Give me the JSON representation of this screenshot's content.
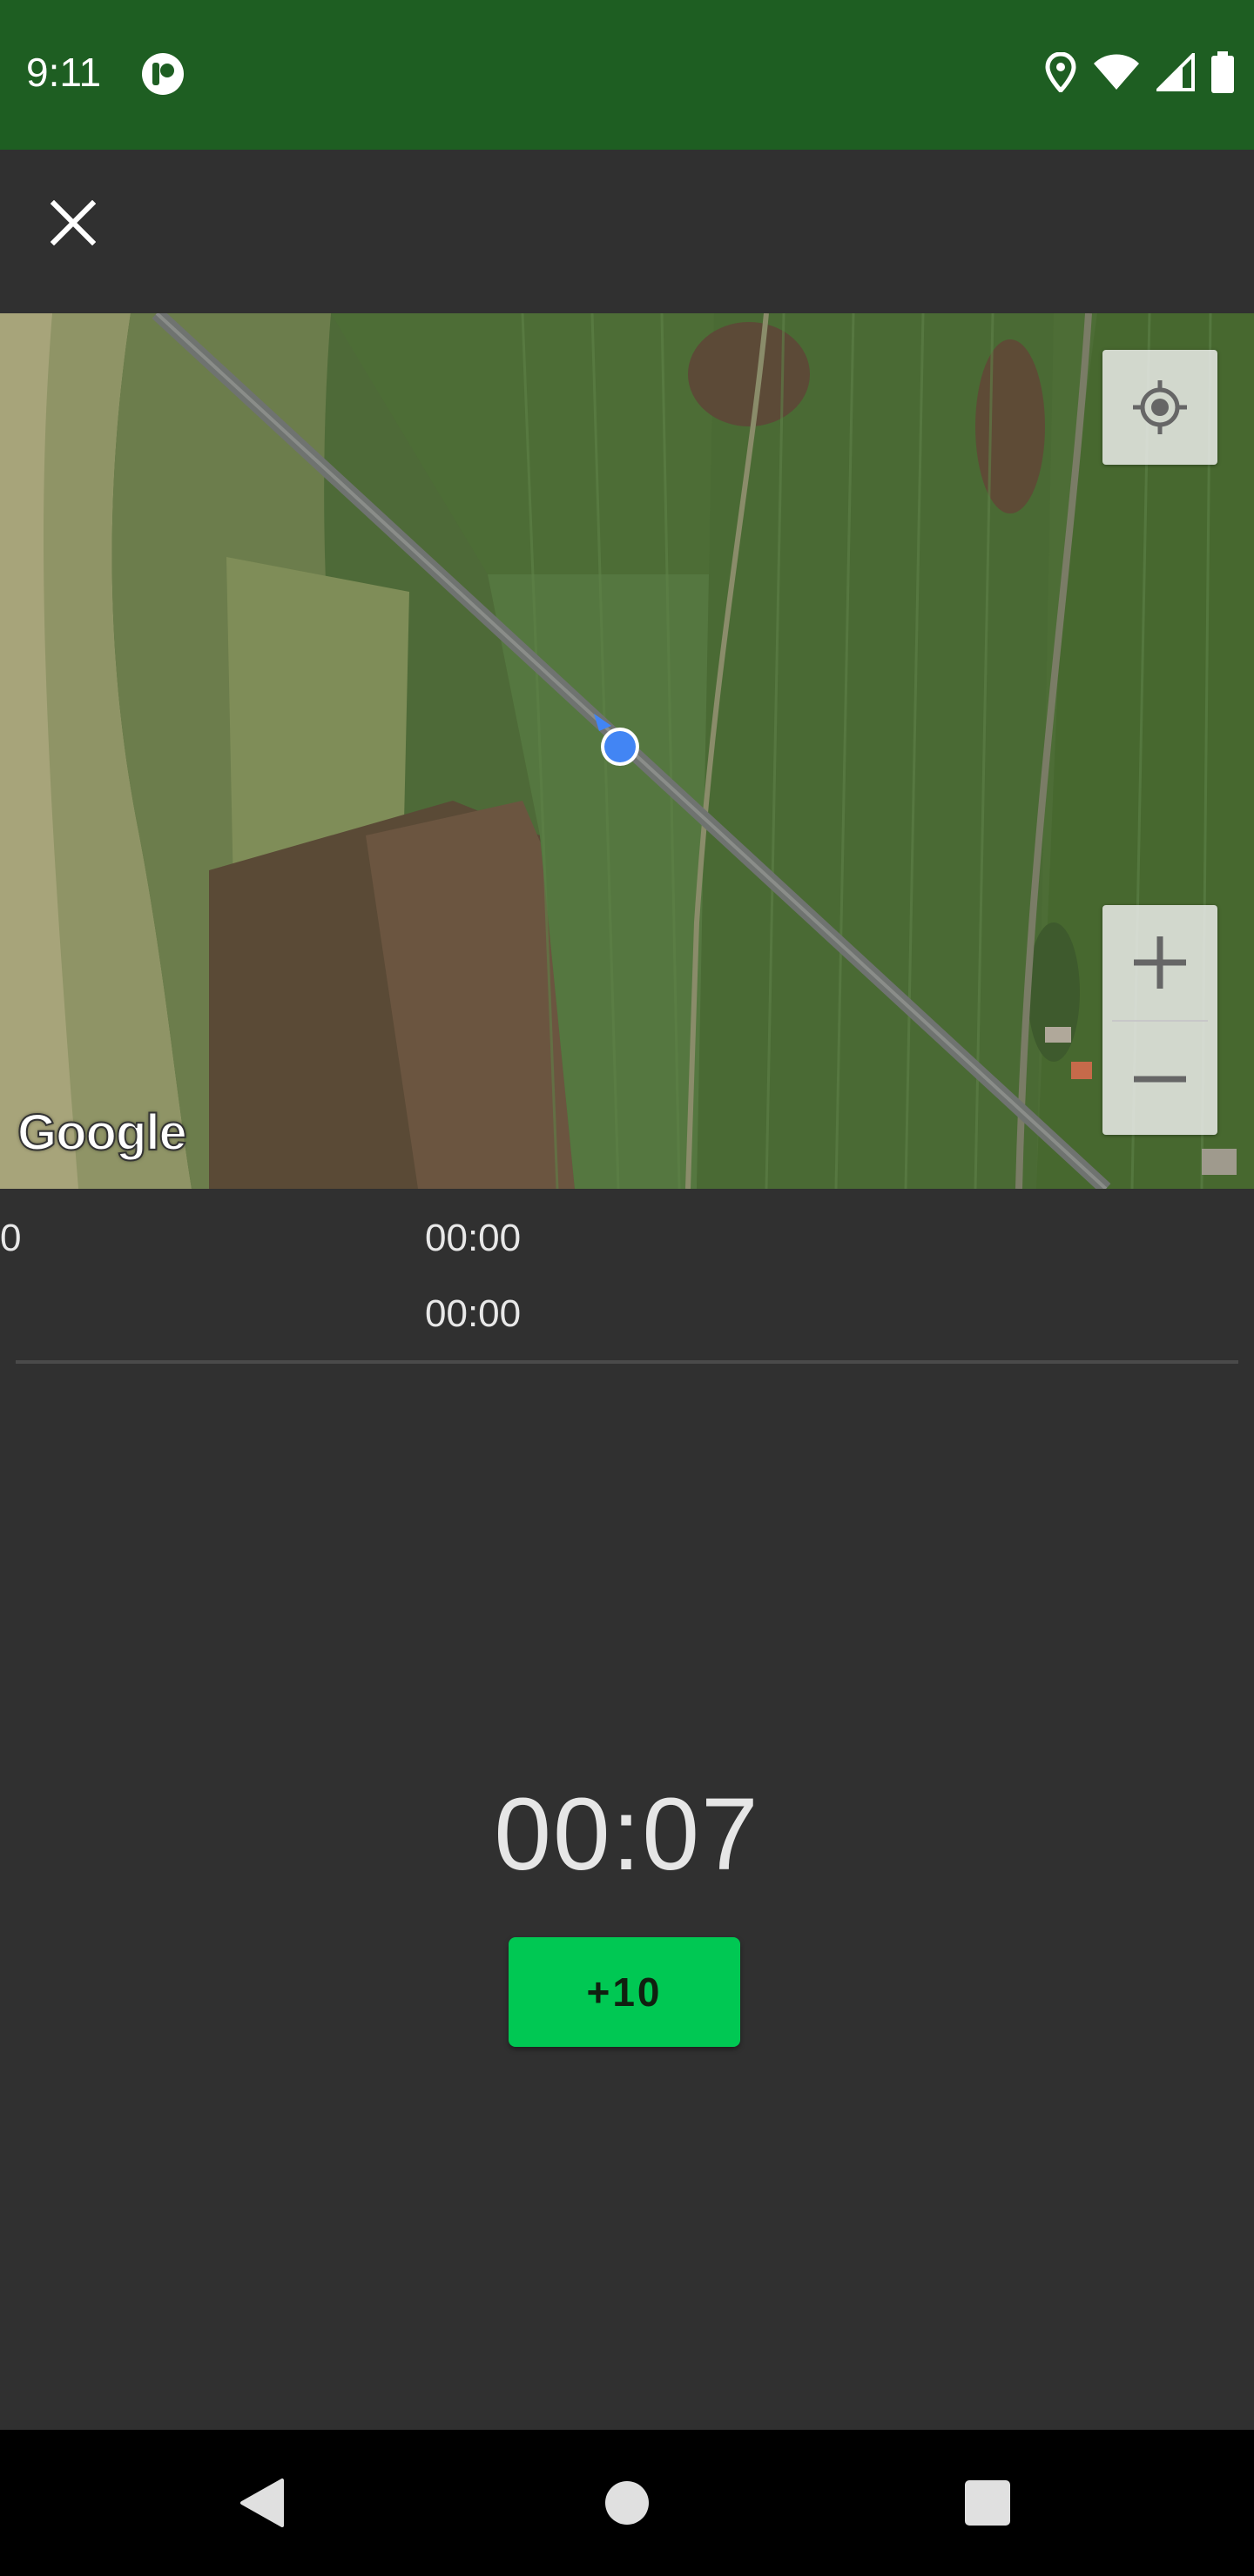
{
  "status_bar": {
    "time": "9:11"
  },
  "toolbar": {
    "close_icon": "close-icon"
  },
  "map": {
    "attribution": "Google",
    "locate_icon": "my-location-icon",
    "zoom_in_icon": "plus-icon",
    "zoom_out_icon": "minus-icon"
  },
  "info": {
    "left_value": "0",
    "time_1": "00:00",
    "time_2": "00:00"
  },
  "timer": {
    "value": "00:07"
  },
  "add_button": {
    "label": "+10",
    "color": "#00c853"
  },
  "nav_bar": {
    "back_icon": "back-triangle-icon",
    "home_icon": "home-circle-icon",
    "recents_icon": "recents-square-icon"
  },
  "colors": {
    "status_bar": "#1e5e22",
    "background": "#303030",
    "location_dot": "#4285f4"
  }
}
